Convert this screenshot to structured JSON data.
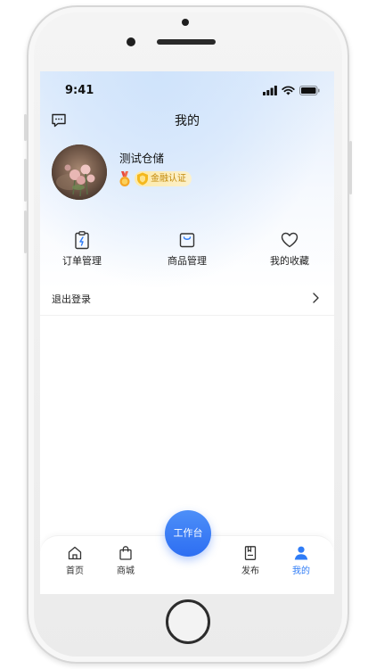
{
  "status_bar": {
    "time": "9:41"
  },
  "header": {
    "title": "我的",
    "message_icon": "message-icon"
  },
  "profile": {
    "username": "测试仓储",
    "badge_label": "金融认证",
    "medal_icon": "medal-icon",
    "badge_icon": "shield-icon"
  },
  "quick_entries": [
    {
      "label": "订单管理",
      "icon": "order-clipboard-icon"
    },
    {
      "label": "商品管理",
      "icon": "product-bag-icon"
    },
    {
      "label": "我的收藏",
      "icon": "heart-icon"
    }
  ],
  "menu": {
    "logout_label": "退出登录",
    "chevron_icon": "chevron-right-icon"
  },
  "tabbar": {
    "items": [
      {
        "label": "首页",
        "icon": "home-icon"
      },
      {
        "label": "商城",
        "icon": "shopping-bag-icon"
      },
      {
        "label": "发布",
        "icon": "publish-icon"
      },
      {
        "label": "我的",
        "icon": "user-icon"
      }
    ],
    "active_index": 3,
    "center_button_label": "工作台"
  },
  "colors": {
    "accent": "#2f7cf6",
    "badge_text": "#c38a0c",
    "badge_bg": "#fde9a8"
  }
}
